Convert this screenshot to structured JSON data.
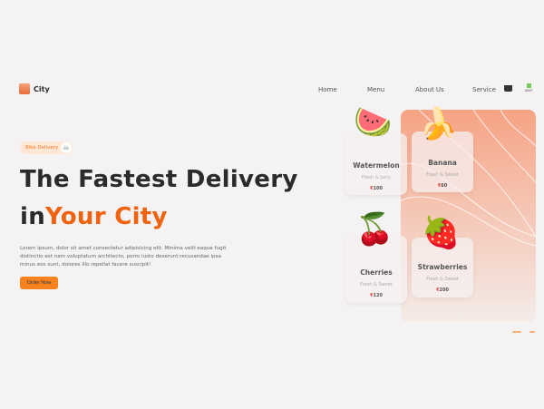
{
  "header": {
    "logo_text": "City",
    "nav": [
      "Home",
      "Menu",
      "About Us",
      "Service"
    ],
    "avatar_label": "user"
  },
  "hero": {
    "badge": "Bike Delivery",
    "title_line1": "The Fastest Delivery",
    "title_in": "in",
    "title_highlight": "Your City",
    "description": "Lorem ipsum, dolor sit amet consectetur adipisicing elit. Minima velit eaque fugit distinctio est nam voluptatum architecto, porro iusto deserunt recusandae ipsa minus eos sunt, dolores illo repellat facere suscipit!",
    "cta": "Order Now"
  },
  "products": [
    {
      "name": "Watermelon",
      "desc": "Fresh & Juicy",
      "price": "100",
      "emoji": "🍉"
    },
    {
      "name": "Banana",
      "desc": "Fresh & Sweet",
      "price": "60",
      "emoji": "🍌"
    },
    {
      "name": "Cherries",
      "desc": "Fresh & Sweet",
      "price": "120",
      "emoji": "🍒"
    },
    {
      "name": "Strawberries",
      "desc": "Fresh & Sweet",
      "price": "200",
      "emoji": "🍓"
    }
  ],
  "colors": {
    "accent": "#f0620e",
    "button": "#f7821e",
    "panel": "#f6a384"
  }
}
